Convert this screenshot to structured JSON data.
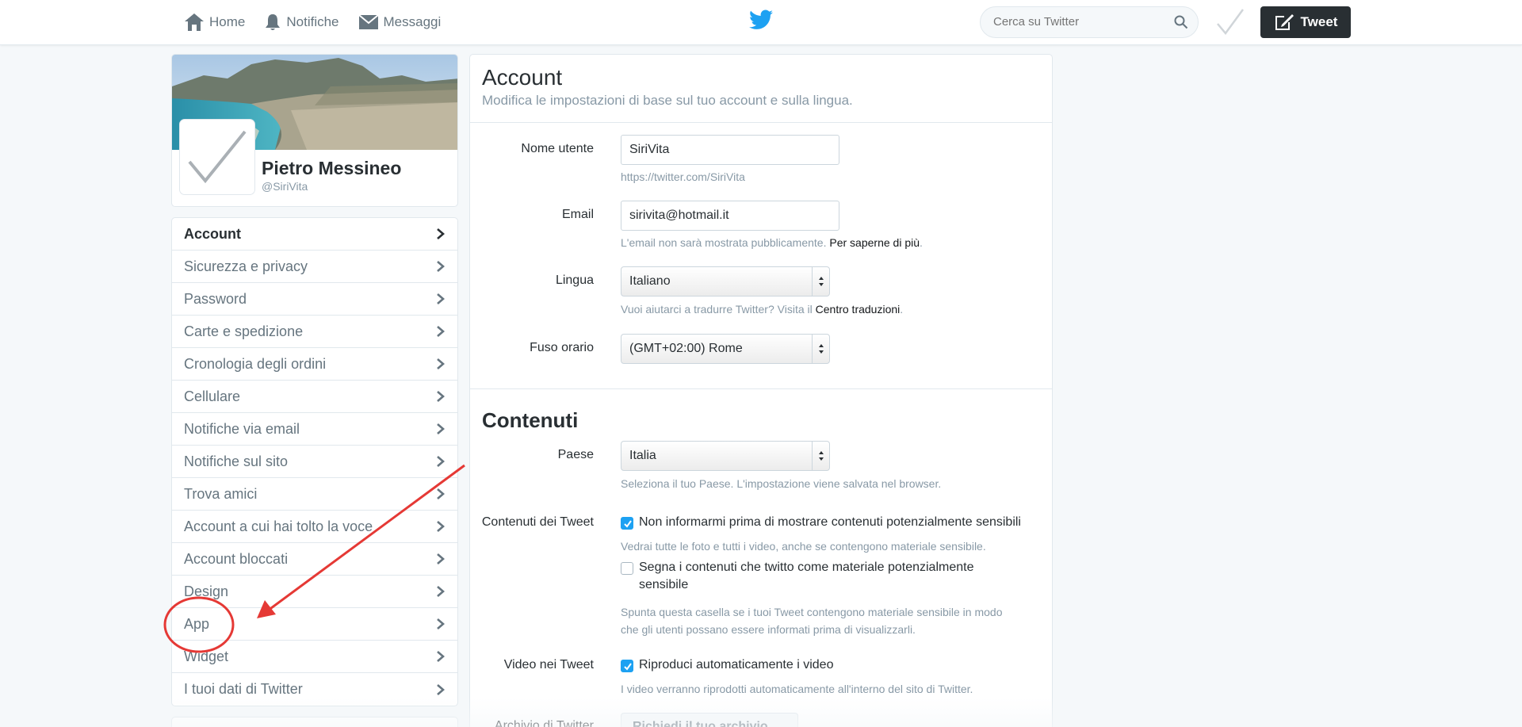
{
  "nav": {
    "home_label": "Home",
    "notifications_label": "Notifiche",
    "messages_label": "Messaggi",
    "search_placeholder": "Cerca su Twitter",
    "tweet_label": "Tweet"
  },
  "profile": {
    "name": "Pietro Messineo",
    "handle": "@SiriVita"
  },
  "menu": {
    "items": [
      {
        "label": "Account",
        "active": true
      },
      {
        "label": "Sicurezza e privacy"
      },
      {
        "label": "Password"
      },
      {
        "label": "Carte e spedizione"
      },
      {
        "label": "Cronologia degli ordini"
      },
      {
        "label": "Cellulare"
      },
      {
        "label": "Notifiche via email"
      },
      {
        "label": "Notifiche sul sito"
      },
      {
        "label": "Trova amici"
      },
      {
        "label": "Account a cui hai tolto la voce"
      },
      {
        "label": "Account bloccati"
      },
      {
        "label": "Design"
      },
      {
        "label": "App"
      },
      {
        "label": "Widget"
      },
      {
        "label": "I tuoi dati di Twitter"
      }
    ]
  },
  "account": {
    "title": "Account",
    "subtitle": "Modifica le impostazioni di base sul tuo account e sulla lingua.",
    "username": {
      "label": "Nome utente",
      "value": "SiriVita",
      "hint": "https://twitter.com/SiriVita"
    },
    "email": {
      "label": "Email",
      "value": "sirivita@hotmail.it",
      "hint_text": "L'email non sarà mostrata pubblicamente.",
      "hint_link": "Per saperne di più",
      "hint_end": "."
    },
    "language": {
      "label": "Lingua",
      "value": "Italiano",
      "hint_text": "Vuoi aiutarci a tradurre Twitter? Visita il",
      "hint_link": "Centro traduzioni",
      "hint_end": "."
    },
    "timezone": {
      "label": "Fuso orario",
      "value": "(GMT+02:00) Rome"
    }
  },
  "content": {
    "title": "Contenuti",
    "country": {
      "label": "Paese",
      "value": "Italia",
      "hint": "Seleziona il tuo Paese. L'impostazione viene salvata nel browser."
    },
    "tweet_content": {
      "label": "Contenuti dei Tweet",
      "option1": "Non informarmi prima di mostrare contenuti potenzialmente sensibili",
      "option1_checked": true,
      "option1_hint": "Vedrai tutte le foto e tutti i video, anche se contengono materiale sensibile.",
      "option2_line1": "Segna i contenuti che twitto come materiale potenzialmente",
      "option2_line2": "sensibile",
      "option2_checked": false,
      "option2_hint_line1": "Spunta questa casella se i tuoi Tweet contengono materiale sensibile in modo",
      "option2_hint_line2": "che gli utenti possano essere informati prima di visualizzarli."
    },
    "video": {
      "label": "Video nei Tweet",
      "option": "Riproduci automaticamente i video",
      "checked": true,
      "hint": "I video verranno riprodotti automaticamente all'interno del sito di Twitter."
    },
    "archive": {
      "label": "Archivio di Twitter",
      "button": "Richiedi il tuo archivio"
    }
  },
  "colors": {
    "twitter_blue": "#1da1f2",
    "annotation_red": "#e53935",
    "dark": "#292f33"
  }
}
